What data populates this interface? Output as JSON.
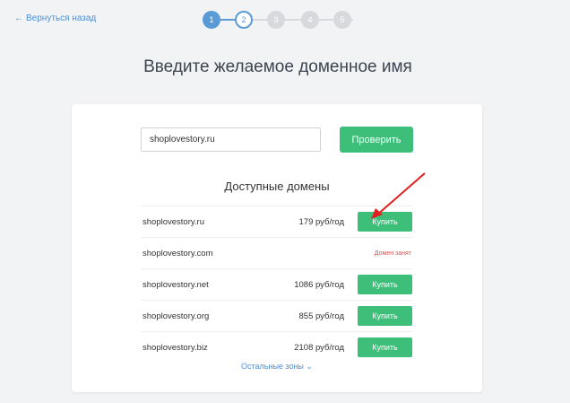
{
  "nav": {
    "back_label": "Вернуться назад"
  },
  "steps": [
    {
      "label": "1",
      "state": "active"
    },
    {
      "label": "2",
      "state": "current"
    },
    {
      "label": "3",
      "state": "pending"
    },
    {
      "label": "4",
      "state": "pending"
    },
    {
      "label": "5",
      "state": "pending"
    }
  ],
  "page": {
    "title": "Введите желаемое доменное имя"
  },
  "search": {
    "value": "shoplovestory.ru",
    "button_label": "Проверить"
  },
  "results": {
    "title": "Доступные домены",
    "rows": [
      {
        "domain": "shoplovestory.ru",
        "price": "179 руб/год",
        "action": "Купить"
      },
      {
        "domain": "shoplovestory.com",
        "status": "Домен занят"
      },
      {
        "domain": "shoplovestory.net",
        "price": "1086 руб/год",
        "action": "Купить"
      },
      {
        "domain": "shoplovestory.org",
        "price": "855 руб/год",
        "action": "Купить"
      },
      {
        "domain": "shoplovestory.biz",
        "price": "2108 руб/год",
        "action": "Купить"
      }
    ],
    "more_label": "Остальные зоны"
  },
  "colors": {
    "accent_green": "#3dbf7a",
    "step_blue": "#5b9bd5",
    "link_blue": "#4a90d9",
    "taken_red": "#d9534f",
    "annotation_arrow": "#e02020"
  },
  "icons": {
    "back": "arrow-left-icon",
    "more": "chevron-down-icon",
    "annotation": "red-arrow-icon"
  }
}
